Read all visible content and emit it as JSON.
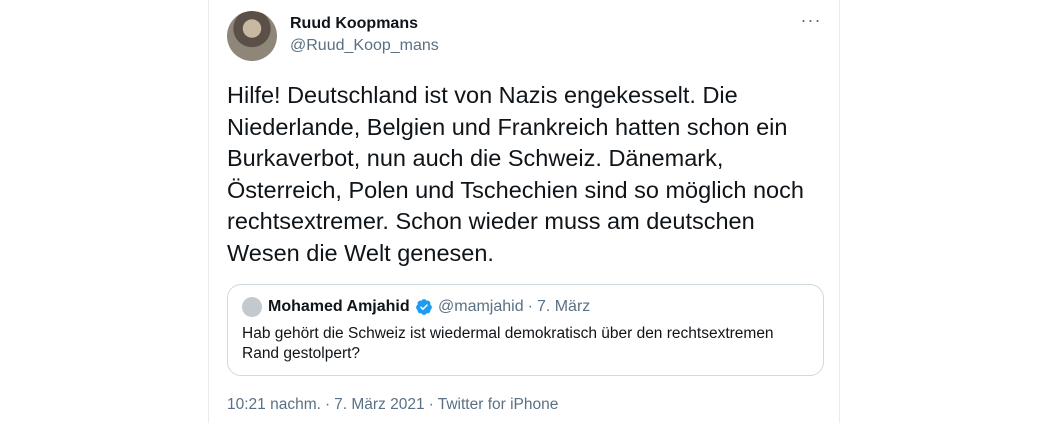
{
  "tweet": {
    "author_name": "Ruud Koopmans",
    "author_handle": "@Ruud_Koop_mans",
    "more_icon": "more-horizontal-icon",
    "text": "Hilfe! Deutschland ist von Nazis engekesselt. Die Niederlande, Belgien und Frankreich hatten schon ein Burkaverbot, nun auch die Schweiz. Dänemark, Österreich, Polen und Tschechien sind so möglich noch rechtsextremer. Schon wieder muss am deutschen Wesen die Welt genesen.",
    "time": "10:21 nachm.",
    "date": "7. März 2021",
    "source": "Twitter for iPhone"
  },
  "quoted": {
    "author_name": "Mohamed Amjahid",
    "verified_icon": "verified-badge-icon",
    "author_handle": "@mamjahid",
    "date": "7. März",
    "text": "Hab gehört die Schweiz ist wiedermal demokratisch über den rechtsextremen Rand gestolpert?"
  },
  "separator": "·",
  "colors": {
    "verified": "#1d9bf0",
    "secondary_text": "#5b7083",
    "primary_text": "#0f1419",
    "border": "#cfd9de"
  }
}
